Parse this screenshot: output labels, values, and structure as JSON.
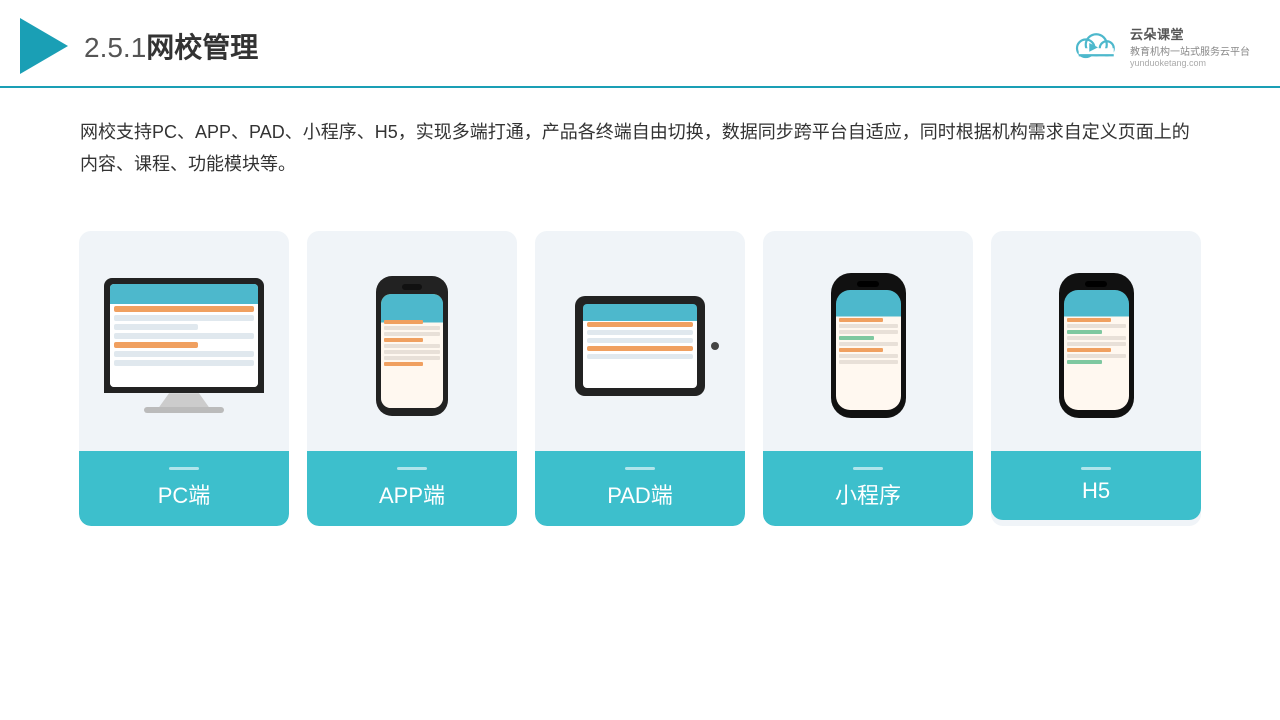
{
  "header": {
    "title": "2.5.1网校管理",
    "title_num": "2.5.1",
    "title_text": "网校管理"
  },
  "brand": {
    "name": "云朵课堂",
    "tagline": "教育机构一站式服务云平台",
    "url": "yunduoketang.com"
  },
  "description": {
    "text": "网校支持PC、APP、PAD、小程序、H5，实现多端打通，产品各终端自由切换，数据同步跨平台自适应，同时根据机构需求自定义页面上的内容、课程、功能模块等。"
  },
  "cards": [
    {
      "id": "pc",
      "label": "PC端"
    },
    {
      "id": "app",
      "label": "APP端"
    },
    {
      "id": "pad",
      "label": "PAD端"
    },
    {
      "id": "miniprogram",
      "label": "小程序"
    },
    {
      "id": "h5",
      "label": "H5"
    }
  ]
}
